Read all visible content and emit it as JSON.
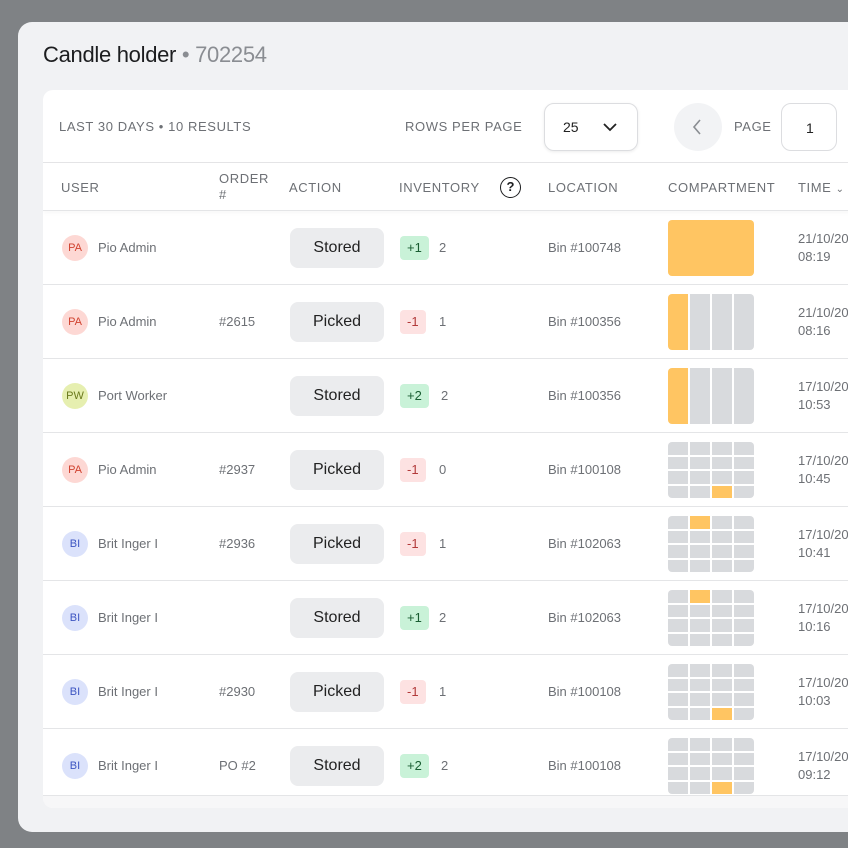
{
  "header": {
    "title": "Candle holder",
    "separator": " • ",
    "item_id": "702254"
  },
  "toolbar": {
    "summary": "LAST 30 DAYS • 10 RESULTS",
    "rows_per_page_label": "ROWS PER PAGE",
    "rows_per_page_value": "25",
    "page_label": "PAGE",
    "page_value": "1"
  },
  "columns": {
    "user": "USER",
    "order": "ORDER #",
    "action": "ACTION",
    "inventory": "INVENTORY",
    "help": "?",
    "location": "LOCATION",
    "compartment": "COMPARTMENT",
    "time": "TIME"
  },
  "colors": {
    "highlight": "#ffc562",
    "empty_cell": "#d8dadd",
    "positive_bg": "#c9f2d8",
    "negative_bg": "#fde2e2"
  },
  "rows": [
    {
      "initials": "PA",
      "avatar_bg": "#fdd8d4",
      "avatar_fg": "#d0422f",
      "user": "Pio Admin",
      "order": "",
      "action": "Stored",
      "delta": "+1",
      "sign": "pos",
      "qty": "2",
      "location": "Bin #100748",
      "compartment": {
        "cols": 1,
        "rows": 1,
        "active": [
          0
        ]
      },
      "date": "21/10/20",
      "time": "08:19"
    },
    {
      "initials": "PA",
      "avatar_bg": "#fdd8d4",
      "avatar_fg": "#d0422f",
      "user": "Pio Admin",
      "order": "#2615",
      "action": "Picked",
      "delta": "-1",
      "sign": "neg",
      "qty": "1",
      "location": "Bin #100356",
      "compartment": {
        "cols": 4,
        "rows": 1,
        "active": [
          0
        ]
      },
      "date": "21/10/20",
      "time": "08:16"
    },
    {
      "initials": "PW",
      "avatar_bg": "#e6efb0",
      "avatar_fg": "#6b7a1c",
      "user": "Port Worker",
      "order": "",
      "action": "Stored",
      "delta": "+2",
      "sign": "pos",
      "qty": "2",
      "location": "Bin #100356",
      "compartment": {
        "cols": 4,
        "rows": 1,
        "active": [
          0
        ]
      },
      "date": "17/10/20",
      "time": "10:53"
    },
    {
      "initials": "PA",
      "avatar_bg": "#fdd8d4",
      "avatar_fg": "#d0422f",
      "user": "Pio Admin",
      "order": "#2937",
      "action": "Picked",
      "delta": "-1",
      "sign": "neg",
      "qty": "0",
      "location": "Bin #100108",
      "compartment": {
        "cols": 4,
        "rows": 4,
        "active": [
          14
        ]
      },
      "date": "17/10/20",
      "time": "10:45"
    },
    {
      "initials": "BI",
      "avatar_bg": "#dbe2fb",
      "avatar_fg": "#3d55c2",
      "user": "Brit Inger I",
      "order": "#2936",
      "action": "Picked",
      "delta": "-1",
      "sign": "neg",
      "qty": "1",
      "location": "Bin #102063",
      "compartment": {
        "cols": 4,
        "rows": 4,
        "active": [
          1
        ]
      },
      "date": "17/10/20",
      "time": "10:41"
    },
    {
      "initials": "BI",
      "avatar_bg": "#dbe2fb",
      "avatar_fg": "#3d55c2",
      "user": "Brit Inger I",
      "order": "",
      "action": "Stored",
      "delta": "+1",
      "sign": "pos",
      "qty": "2",
      "location": "Bin #102063",
      "compartment": {
        "cols": 4,
        "rows": 4,
        "active": [
          1
        ]
      },
      "date": "17/10/20",
      "time": "10:16"
    },
    {
      "initials": "BI",
      "avatar_bg": "#dbe2fb",
      "avatar_fg": "#3d55c2",
      "user": "Brit Inger I",
      "order": "#2930",
      "action": "Picked",
      "delta": "-1",
      "sign": "neg",
      "qty": "1",
      "location": "Bin #100108",
      "compartment": {
        "cols": 4,
        "rows": 4,
        "active": [
          14
        ]
      },
      "date": "17/10/20",
      "time": "10:03"
    },
    {
      "initials": "BI",
      "avatar_bg": "#dbe2fb",
      "avatar_fg": "#3d55c2",
      "user": "Brit Inger I",
      "order": "PO #2",
      "action": "Stored",
      "delta": "+2",
      "sign": "pos",
      "qty": "2",
      "location": "Bin #100108",
      "compartment": {
        "cols": 4,
        "rows": 4,
        "active": [
          14
        ]
      },
      "date": "17/10/20",
      "time": "09:12"
    }
  ]
}
